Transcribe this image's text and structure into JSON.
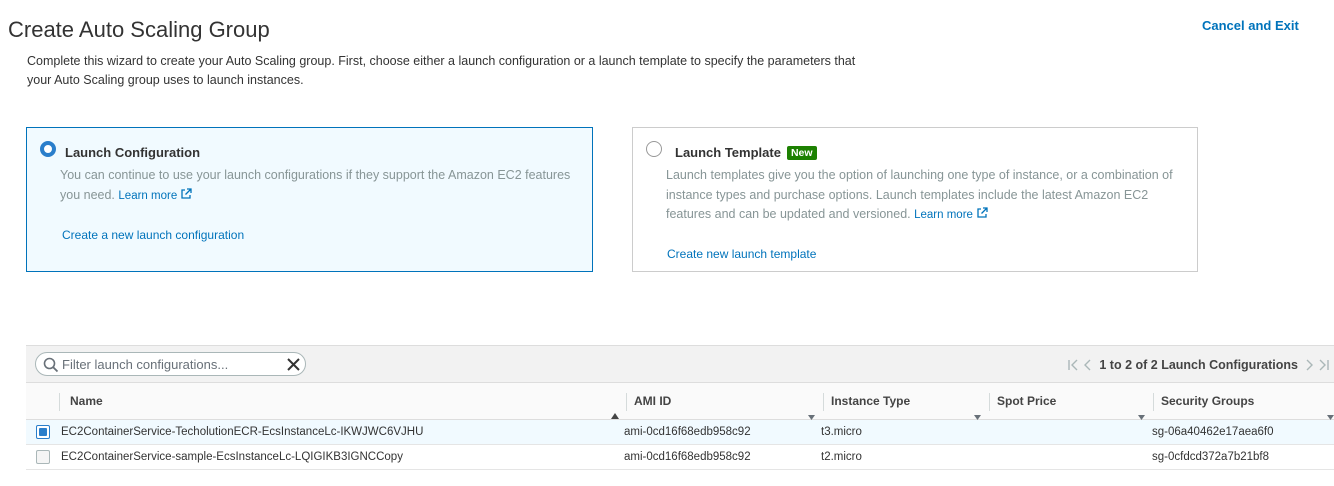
{
  "header": {
    "title": "Create Auto Scaling Group",
    "cancel_label": "Cancel and Exit",
    "intro": "Complete this wizard to create your Auto Scaling group. First, choose either a launch configuration or a launch template to specify the parameters that your Auto Scaling group uses to launch instances."
  },
  "options": {
    "launch_configuration": {
      "title": "Launch Configuration",
      "description": "You can continue to use your launch configurations if they support the Amazon EC2 features you need.",
      "learn_more": "Learn more",
      "action": "Create a new launch configuration",
      "selected": true
    },
    "launch_template": {
      "title": "Launch Template",
      "badge": "New",
      "description": "Launch templates give you the option of launching one type of instance, or a combination of instance types and purchase options. Launch templates include the latest Amazon EC2 features and can be updated and versioned.",
      "learn_more": "Learn more",
      "action": "Create new launch template",
      "selected": false
    }
  },
  "table": {
    "search_placeholder": "Filter launch configurations...",
    "pagination": "1 to 2 of 2 Launch Configurations",
    "columns": [
      "Name",
      "AMI ID",
      "Instance Type",
      "Spot Price",
      "Security Groups"
    ],
    "rows": [
      {
        "selected": true,
        "name": "EC2ContainerService-TecholutionECR-EcsInstanceLc-IKWJWC6VJHU",
        "ami_id": "ami-0cd16f68edb958c92",
        "instance_type": "t3.micro",
        "spot_price": "",
        "security_groups": "sg-06a40462e17aea6f0"
      },
      {
        "selected": false,
        "name": "EC2ContainerService-sample-EcsInstanceLc-LQIGIKB3IGNCCopy",
        "ami_id": "ami-0cd16f68edb958c92",
        "instance_type": "t2.micro",
        "spot_price": "",
        "security_groups": "sg-0cfdcd372a7b21bf8"
      }
    ]
  },
  "colors": {
    "accent": "#0073bb",
    "badge": "#1d8102",
    "selected_bg": "#f1faff"
  },
  "icons": [
    "external-link-icon",
    "search-icon",
    "clear-icon",
    "first-page-icon",
    "prev-page-icon",
    "next-page-icon",
    "last-page-icon",
    "sort-asc-icon",
    "caret-down-icon"
  ]
}
